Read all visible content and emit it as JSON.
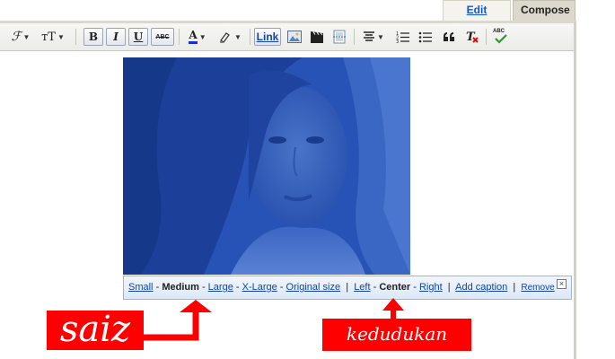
{
  "tabs": {
    "edit_html": "Edit HTML",
    "compose": "Compose"
  },
  "toolbar": {
    "font_glyph": "ℱ",
    "size_glyph": "тT",
    "bold": "B",
    "italic": "I",
    "underline": "U",
    "strike": "ABC",
    "text_color": "A",
    "link": "Link",
    "spell": "ABC"
  },
  "image_bar": {
    "small": "Small",
    "medium": "Medium",
    "large": "Large",
    "xlarge": "X-Large",
    "original": "Original size",
    "left": "Left",
    "center": "Center",
    "right": "Right",
    "add_caption": "Add caption",
    "remove": "Remove",
    "sep_dash": "-",
    "sep_pipe": "|"
  },
  "annotations": {
    "saiz": "saiz",
    "kedudukan": "kedudukan"
  },
  "colors": {
    "accent_link": "#1155cc",
    "photo_tint": "#2a55b8",
    "annotation_red": "#ff0000"
  }
}
